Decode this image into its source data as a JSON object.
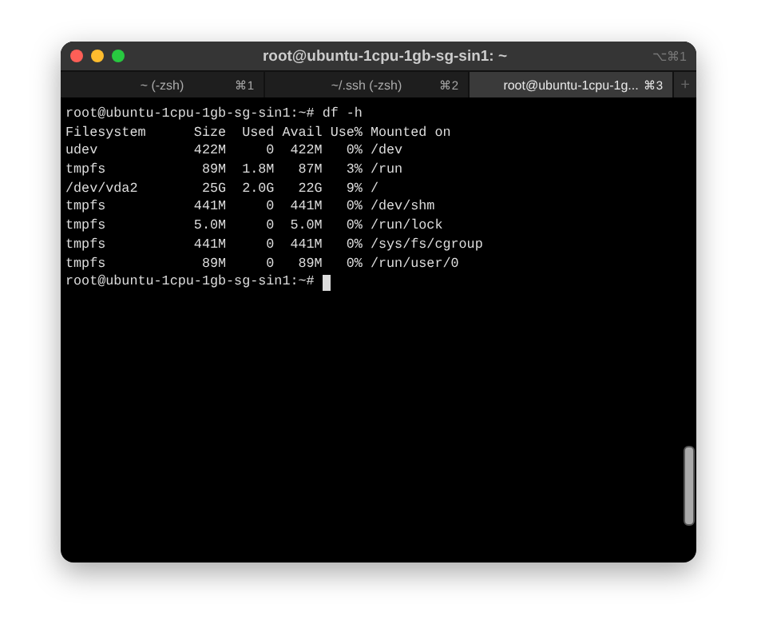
{
  "window": {
    "title": "root@ubuntu-1cpu-1gb-sg-sin1: ~",
    "shortcut": "⌥⌘1"
  },
  "tabs": [
    {
      "label": "~ (-zsh)",
      "shortcut": "⌘1",
      "selected": false
    },
    {
      "label": "~/.ssh (-zsh)",
      "shortcut": "⌘2",
      "selected": false
    },
    {
      "label": "root@ubuntu-1cpu-1g...",
      "shortcut": "⌘3",
      "selected": true
    }
  ],
  "new_tab": "+",
  "terminal": {
    "lines": [
      "root@ubuntu-1cpu-1gb-sg-sin1:~# df -h",
      "Filesystem      Size  Used Avail Use% Mounted on",
      "udev            422M     0  422M   0% /dev",
      "tmpfs            89M  1.8M   87M   3% /run",
      "/dev/vda2        25G  2.0G   22G   9% /",
      "tmpfs           441M     0  441M   0% /dev/shm",
      "tmpfs           5.0M     0  5.0M   0% /run/lock",
      "tmpfs           441M     0  441M   0% /sys/fs/cgroup",
      "tmpfs            89M     0   89M   0% /run/user/0"
    ],
    "prompt": "root@ubuntu-1cpu-1gb-sg-sin1:~#"
  }
}
